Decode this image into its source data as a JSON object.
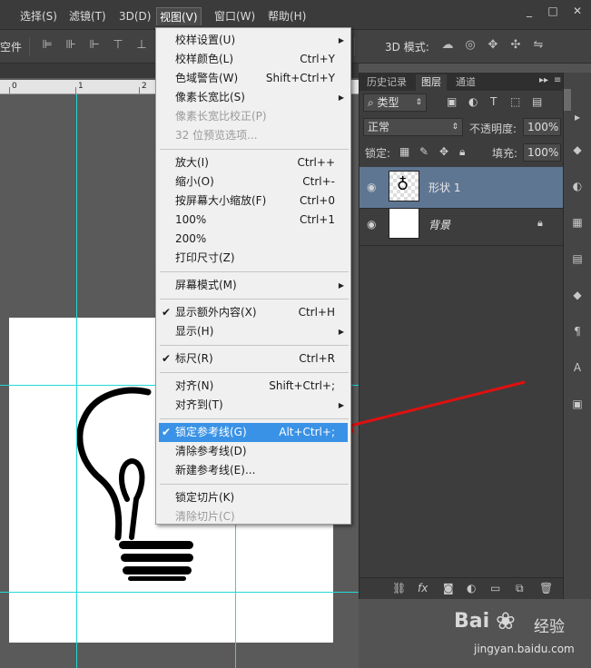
{
  "menubar": {
    "items": [
      "选择(S)",
      "滤镜(T)",
      "3D(D)",
      "视图(V)",
      "窗口(W)",
      "帮助(H)"
    ],
    "window_buttons": [
      "_",
      "□",
      "✕"
    ]
  },
  "options_bar": {
    "left_label": "空件",
    "mode_label": "3D 模式:"
  },
  "ruler": {
    "ticks": [
      "0",
      "1",
      "2"
    ]
  },
  "view_menu": {
    "groups": [
      [
        {
          "label": "校样设置(U)",
          "shortcut": "",
          "submenu": true,
          "disabled": false,
          "checked": false
        },
        {
          "label": "校样颜色(L)",
          "shortcut": "Ctrl+Y",
          "submenu": false,
          "disabled": false,
          "checked": false
        },
        {
          "label": "色域警告(W)",
          "shortcut": "Shift+Ctrl+Y",
          "submenu": false,
          "disabled": false,
          "checked": false
        },
        {
          "label": "像素长宽比(S)",
          "shortcut": "",
          "submenu": true,
          "disabled": false,
          "checked": false
        },
        {
          "label": "像素长宽比校正(P)",
          "shortcut": "",
          "submenu": false,
          "disabled": true,
          "checked": false
        },
        {
          "label": "32 位预览选项...",
          "shortcut": "",
          "submenu": false,
          "disabled": true,
          "checked": false
        }
      ],
      [
        {
          "label": "放大(I)",
          "shortcut": "Ctrl++",
          "submenu": false,
          "disabled": false,
          "checked": false
        },
        {
          "label": "缩小(O)",
          "shortcut": "Ctrl+-",
          "submenu": false,
          "disabled": false,
          "checked": false
        },
        {
          "label": "按屏幕大小缩放(F)",
          "shortcut": "Ctrl+0",
          "submenu": false,
          "disabled": false,
          "checked": false
        },
        {
          "label": "100%",
          "shortcut": "Ctrl+1",
          "submenu": false,
          "disabled": false,
          "checked": false
        },
        {
          "label": "200%",
          "shortcut": "",
          "submenu": false,
          "disabled": false,
          "checked": false
        },
        {
          "label": "打印尺寸(Z)",
          "shortcut": "",
          "submenu": false,
          "disabled": false,
          "checked": false
        }
      ],
      [
        {
          "label": "屏幕模式(M)",
          "shortcut": "",
          "submenu": true,
          "disabled": false,
          "checked": false
        }
      ],
      [
        {
          "label": "显示额外内容(X)",
          "shortcut": "Ctrl+H",
          "submenu": false,
          "disabled": false,
          "checked": true
        },
        {
          "label": "显示(H)",
          "shortcut": "",
          "submenu": true,
          "disabled": false,
          "checked": false
        }
      ],
      [
        {
          "label": "标尺(R)",
          "shortcut": "Ctrl+R",
          "submenu": false,
          "disabled": false,
          "checked": true
        }
      ],
      [
        {
          "label": "对齐(N)",
          "shortcut": "Shift+Ctrl+;",
          "submenu": false,
          "disabled": false,
          "checked": false
        },
        {
          "label": "对齐到(T)",
          "shortcut": "",
          "submenu": true,
          "disabled": false,
          "checked": false
        }
      ],
      [
        {
          "label": "锁定参考线(G)",
          "shortcut": "Alt+Ctrl+;",
          "submenu": false,
          "disabled": false,
          "checked": true,
          "highlighted": true
        },
        {
          "label": "清除参考线(D)",
          "shortcut": "",
          "submenu": false,
          "disabled": false,
          "checked": false
        },
        {
          "label": "新建参考线(E)...",
          "shortcut": "",
          "submenu": false,
          "disabled": false,
          "checked": false
        }
      ],
      [
        {
          "label": "锁定切片(K)",
          "shortcut": "",
          "submenu": false,
          "disabled": false,
          "checked": false
        },
        {
          "label": "清除切片(C)",
          "shortcut": "",
          "submenu": false,
          "disabled": true,
          "checked": false
        }
      ]
    ]
  },
  "layers_panel": {
    "tabs": [
      "历史记录",
      "图层",
      "通道"
    ],
    "active_tab": "图层",
    "filter_kind": "类型",
    "blend_mode": "正常",
    "opacity_label": "不透明度:",
    "opacity_value": "100%",
    "lock_label": "锁定:",
    "fill_label": "填充:",
    "fill_value": "100%",
    "layers": [
      {
        "name": "形状 1",
        "selected": true
      },
      {
        "name": "背景",
        "selected": false,
        "locked": true
      }
    ],
    "footer_icons": [
      "link-icon",
      "fx-icon",
      "mask-icon",
      "adjustment-icon",
      "group-icon",
      "new-layer-icon",
      "trash-icon"
    ]
  },
  "colors": {
    "menu_highlight": "#3a92e6",
    "guide": "#22d8d8",
    "arrow": "#e01010",
    "selected_layer": "#5f7693"
  },
  "watermark": {
    "logo": "Bai",
    "cn": "经验",
    "url": "jingyan.baidu.com"
  }
}
